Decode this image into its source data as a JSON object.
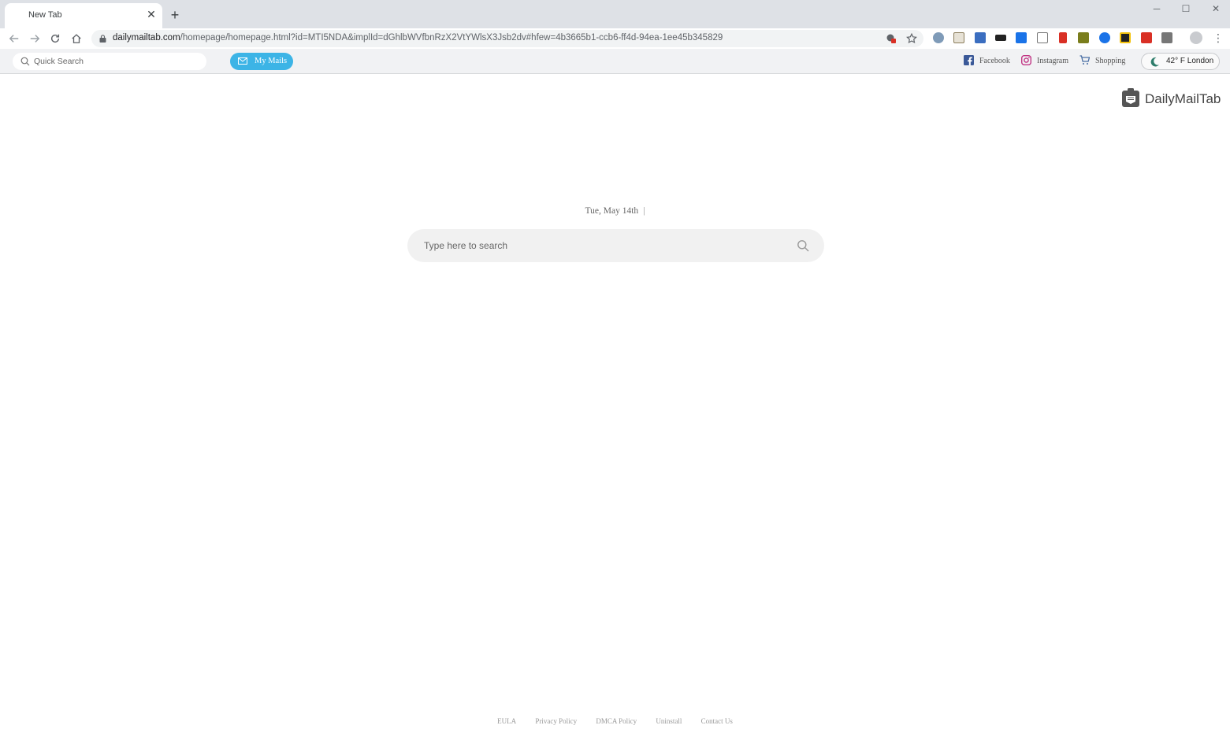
{
  "browser": {
    "tab_title": "New Tab",
    "tab_close_icon": "close-icon",
    "new_tab_icon": "plus-icon",
    "url_host": "dailymailtab.com",
    "url_path": "/homepage/homepage.html?id=MTI5NDA&implId=dGhlbWVfbnRzX2VtYWlsX3Jsb2dv#hfew=4b3665b1-ccb6-ff4d-94ea-1ee45b345829"
  },
  "header": {
    "quick_search_placeholder": "Quick Search",
    "my_mails_label": "My Mails",
    "links": [
      {
        "label": "Facebook",
        "icon": "facebook-icon"
      },
      {
        "label": "Instagram",
        "icon": "instagram-icon"
      },
      {
        "label": "Shopping",
        "icon": "cart-icon"
      }
    ],
    "weather": "42° F London",
    "weather_icon": "moon-icon"
  },
  "brand": {
    "name": "DailyMailTab",
    "icon": "mail-clipboard-icon"
  },
  "main": {
    "date": "Tue, May 14th",
    "date_separator": "|",
    "search_placeholder": "Type here to search"
  },
  "footer": {
    "links": [
      "EULA",
      "Privacy Policy",
      "DMCA Policy",
      "Uninstall",
      "Contact Us"
    ]
  },
  "colors": {
    "my_mails_button": "#3cb4e6",
    "tabstrip": "#dee1e6",
    "pagebar": "#f1f2f4"
  }
}
